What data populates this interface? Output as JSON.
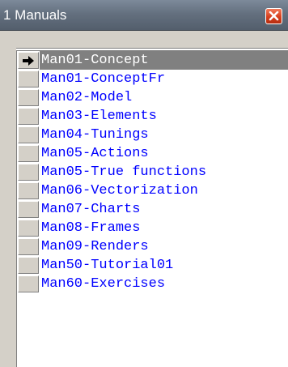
{
  "window": {
    "title": "1 Manuals",
    "close_icon": "close-icon"
  },
  "list": {
    "selected_index": 0,
    "items": [
      {
        "label": "Man01-Concept"
      },
      {
        "label": "Man01-ConceptFr"
      },
      {
        "label": "Man02-Model"
      },
      {
        "label": "Man03-Elements"
      },
      {
        "label": "Man04-Tunings"
      },
      {
        "label": "Man05-Actions"
      },
      {
        "label": "Man05-True functions"
      },
      {
        "label": "Man06-Vectorization"
      },
      {
        "label": "Man07-Charts"
      },
      {
        "label": "Man08-Frames"
      },
      {
        "label": "Man09-Renders"
      },
      {
        "label": "Man50-Tutorial01"
      },
      {
        "label": "Man60-Exercises"
      }
    ]
  },
  "colors": {
    "link": "#0000ff",
    "selected_bg": "#808080",
    "selected_text": "#ffffff"
  }
}
